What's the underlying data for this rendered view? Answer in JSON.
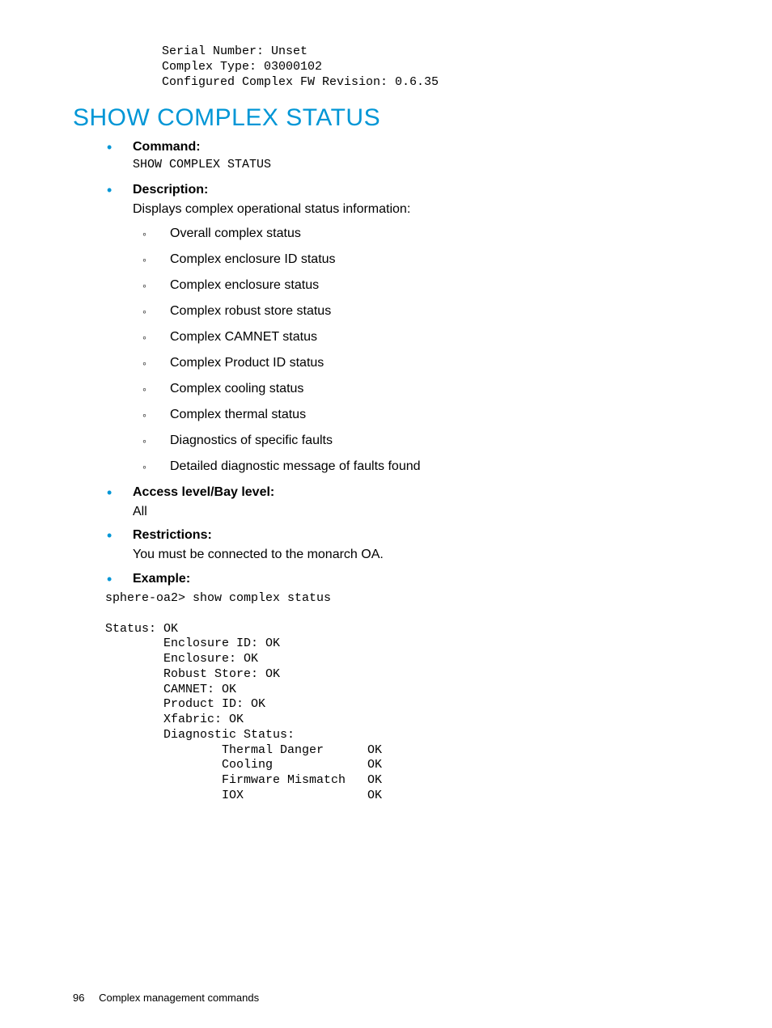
{
  "top_pre": "Serial Number: Unset\nComplex Type: 03000102\nConfigured Complex FW Revision: 0.6.35",
  "section_title": "SHOW COMPLEX STATUS",
  "items": {
    "command": {
      "label": "Command:",
      "value": "SHOW COMPLEX STATUS"
    },
    "description": {
      "label": "Description:",
      "intro": "Displays complex operational status information:",
      "list": [
        "Overall complex status",
        "Complex enclosure ID status",
        "Complex enclosure status",
        "Complex robust store status",
        "Complex CAMNET status",
        "Complex Product ID status",
        "Complex cooling status",
        "Complex thermal status",
        "Diagnostics of specific faults",
        "Detailed diagnostic message of faults found"
      ]
    },
    "access": {
      "label": "Access level/Bay level:",
      "value": "All"
    },
    "restrictions": {
      "label": "Restrictions:",
      "value": "You must be connected to the monarch OA."
    },
    "example": {
      "label": "Example:",
      "value": "sphere-oa2> show complex status\n\nStatus: OK\n        Enclosure ID: OK\n        Enclosure: OK\n        Robust Store: OK\n        CAMNET: OK\n        Product ID: OK\n        Xfabric: OK\n        Diagnostic Status:\n                Thermal Danger      OK\n                Cooling             OK\n                Firmware Mismatch   OK\n                IOX                 OK"
    }
  },
  "footer": {
    "page_number": "96",
    "chapter": "Complex management commands"
  }
}
